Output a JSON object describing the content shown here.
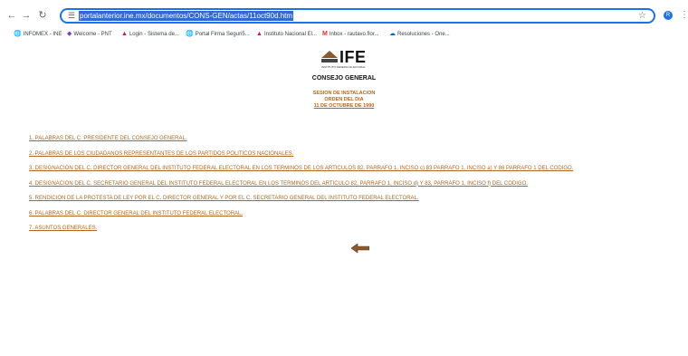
{
  "browser": {
    "url": "portalanterior.ine.mx/documentos/CONS-GEN/actas/11oct90d.htm",
    "profile_initial": "R"
  },
  "bookmarks": [
    {
      "label": "INFOMEX - INE",
      "icon": "globe-icon"
    },
    {
      "label": "Welcome - PNT",
      "icon": "diamond-icon"
    },
    {
      "label": "Login - Sistema de...",
      "icon": "ine-icon"
    },
    {
      "label": "Portal Firma Seguri5...",
      "icon": "globe-icon"
    },
    {
      "label": "Instituto Nacional El...",
      "icon": "ine-icon"
    },
    {
      "label": "Inbox - rautavo.flor...",
      "icon": "gmail-icon"
    },
    {
      "label": "Resoluciones - One...",
      "icon": "cloud-icon"
    }
  ],
  "page": {
    "logo_text": "IFE",
    "logo_subtitle": "INSTITUTO FEDERAL ELECTORAL",
    "heading": "CONSEJO GENERAL",
    "session_line1": "SESION DE INSTALACION",
    "session_line2": "ORDEN DEL DIA",
    "session_line3": "11 DE OCTUBRE DE 1990",
    "agenda": [
      "1. PALABRAS DEL C. PRESIDENTE DEL CONSEJO GENERAL.",
      "2. PALABRAS DE LOS CIUDADANOS REPRESENTANTES DE LOS PARTIDOS POLITICOS NACIONALES.",
      "3. DESIGNACION DEL C. DIRECTOR GENERAL DEL INSTITUTO FEDERAL ELECTORAL EN LOS TERMINOS DE LOS ARTICULOS 82, PARRAFO 1, INCISO c) 83 PARRAFO 1, INCISO a) Y 86 PARRAFO 1 DEL CODIGO.",
      "4. DESIGNACION DEL C. SECRETARIO GENERAL DEL INSTITUTO FEDERAL ELECTORAL EN LOS TERMINOS DEL ARTICULO 82, PARRAFO 1, INCISO d) Y 83, PARRAFO 1, INCISO f) DEL CODIGO.",
      "5. RENDICION DE LA PROTESTA DE LEY POR EL C. DIRECTOR GENERAL Y POR EL C. SECRETARIO GENERAL DEL INSTITUTO FEDERAL ELECTORAL.",
      "6. PALABRAS DEL C. DIRECTOR GENERAL DEL INSTITUTO FEDERAL ELECTORAL.",
      "7. ASUNTOS GENERALES."
    ]
  },
  "colors": {
    "link": "#b5651d",
    "omnibox_border": "#1a73e8",
    "selection": "#3367d6"
  }
}
